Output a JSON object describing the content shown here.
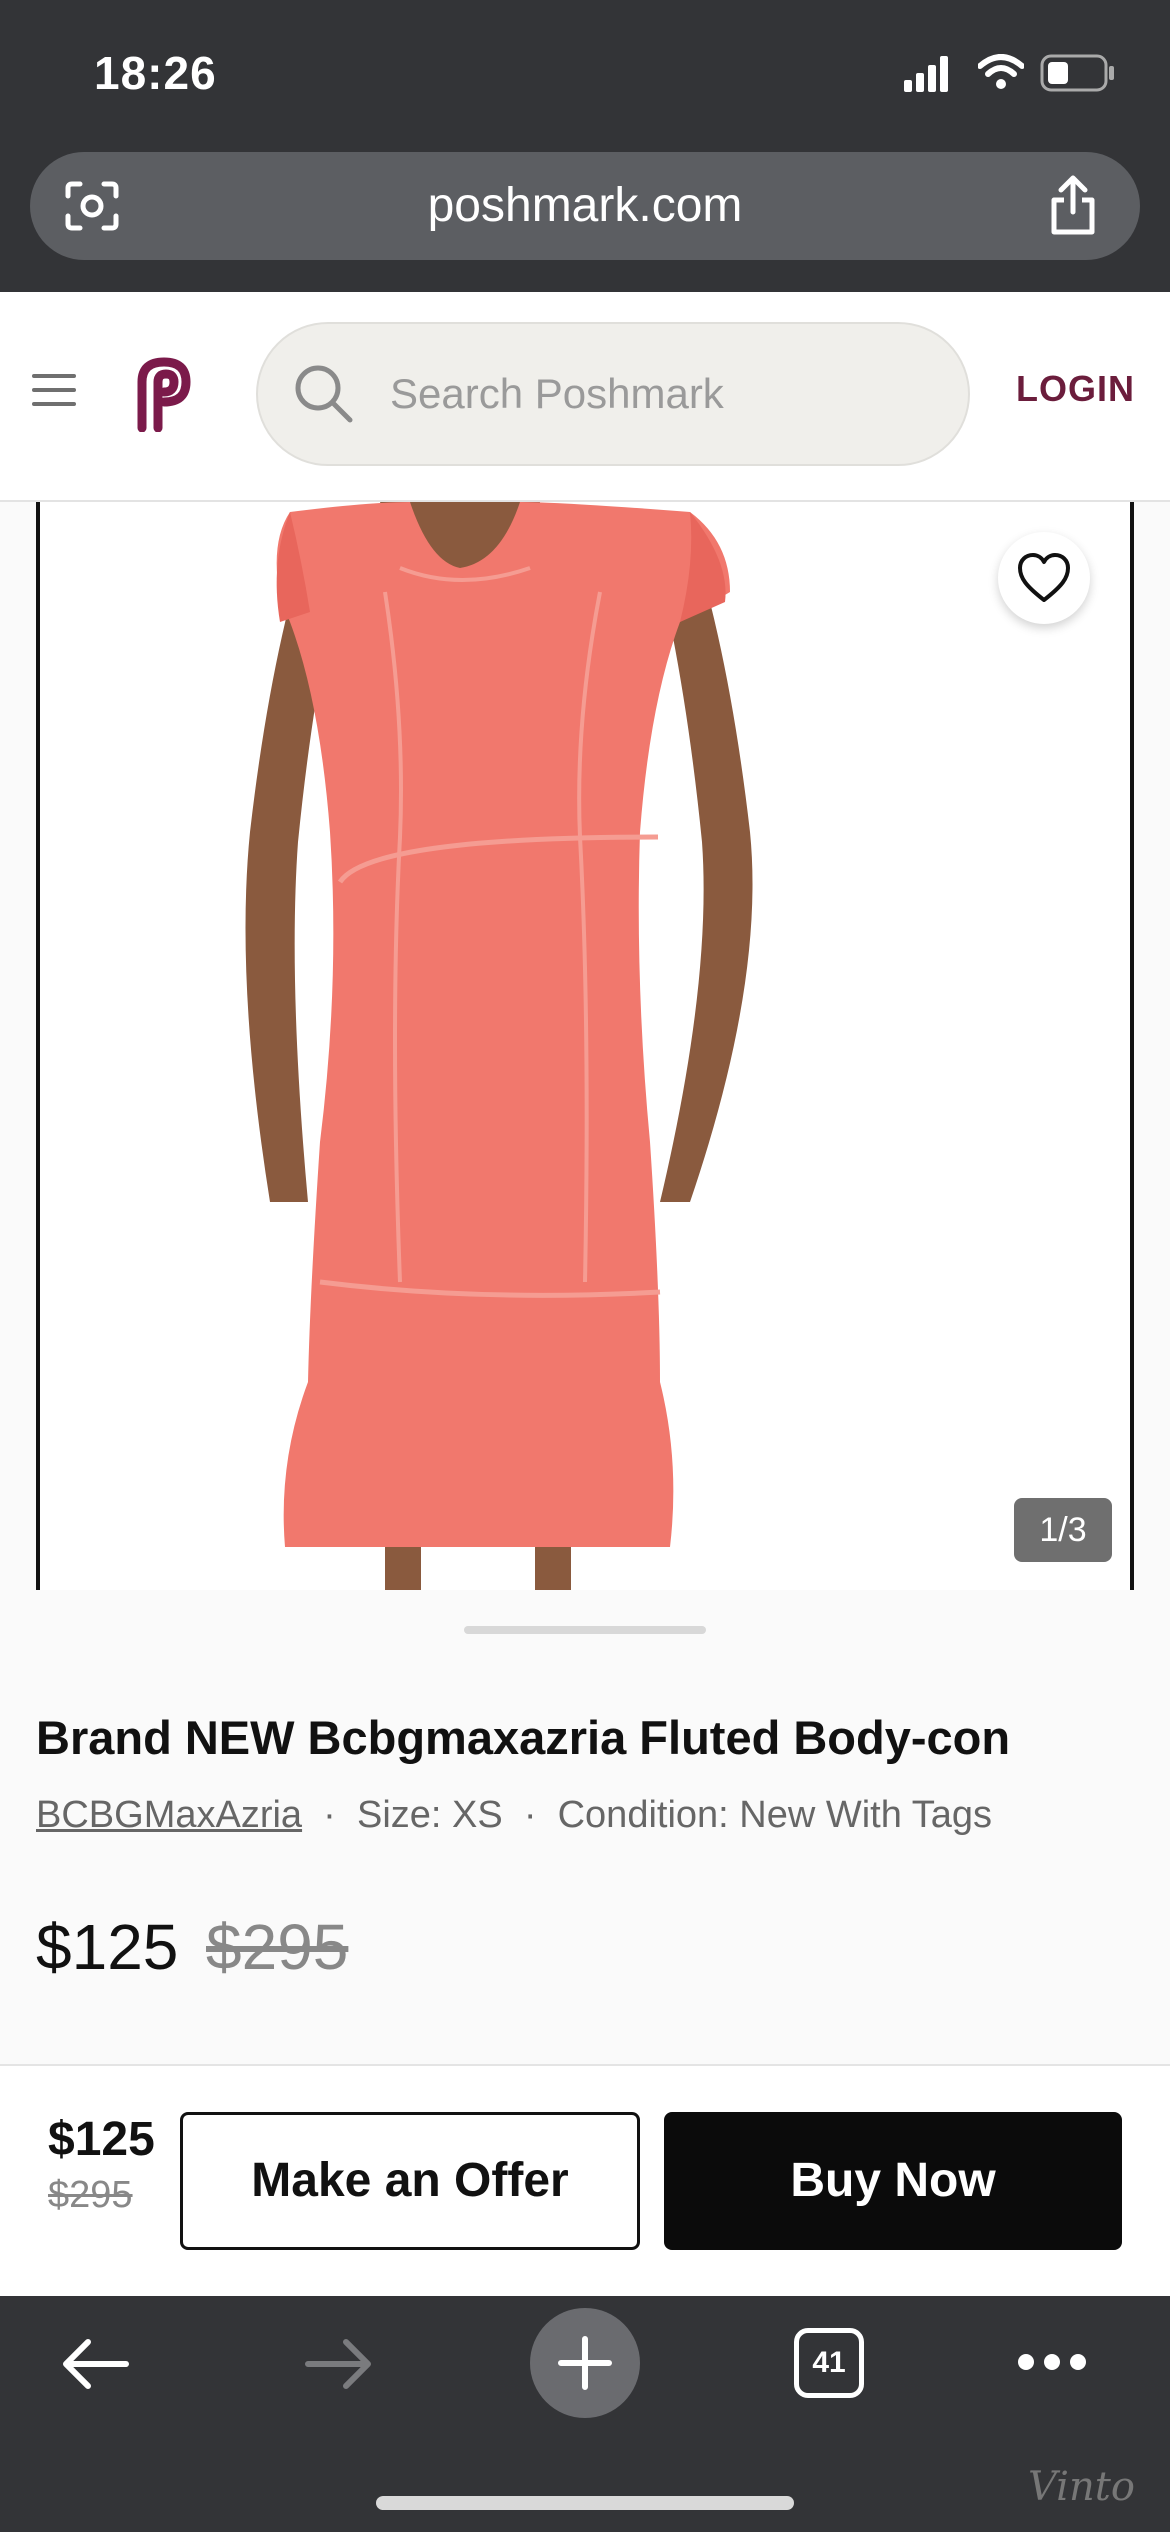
{
  "status": {
    "time": "18:26"
  },
  "browser": {
    "url": "poshmark.com"
  },
  "header": {
    "search_placeholder": "Search Poshmark",
    "login": "LOGIN"
  },
  "listing": {
    "image_counter": "1/3",
    "title": "Brand NEW Bcbgmaxazria Fluted Body-con",
    "brand": "BCBGMaxAzria",
    "size": "Size: XS",
    "condition": "Condition: New With Tags",
    "price": "$125",
    "original_price": "$295"
  },
  "buy_bar": {
    "price": "$125",
    "original_price": "$295",
    "offer_label": "Make an Offer",
    "buy_label": "Buy Now"
  },
  "toolbar": {
    "tab_count": "41"
  },
  "watermark": "Vinto",
  "colors": {
    "brand": "#6b1d3c",
    "dress": "#f1786d",
    "chrome": "#333437"
  }
}
